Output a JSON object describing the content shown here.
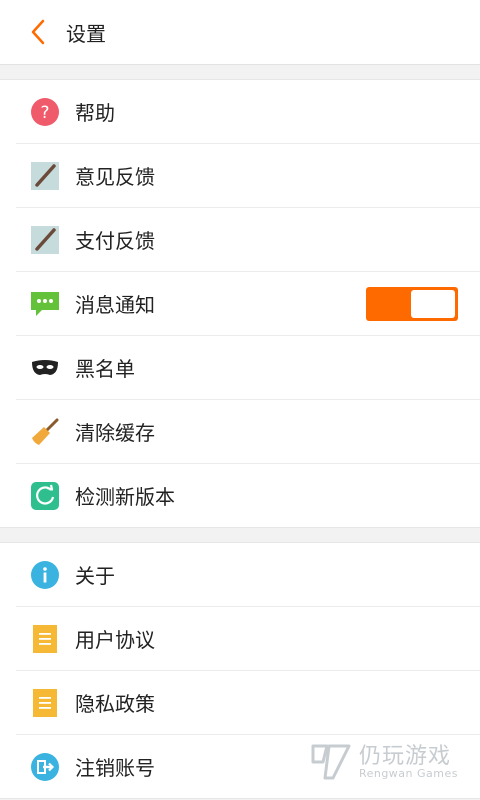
{
  "header": {
    "title": "设置",
    "back_icon": "chevron-left-icon",
    "accent": "#ff6a00"
  },
  "groups": [
    {
      "items": [
        {
          "label": "帮助",
          "icon": "help-icon"
        },
        {
          "label": "意见反馈",
          "icon": "pencil-icon"
        },
        {
          "label": "支付反馈",
          "icon": "pencil-icon"
        },
        {
          "label": "消息通知",
          "icon": "chat-bubble-icon",
          "toggle": {
            "on": true,
            "color": "#ff6a00"
          }
        },
        {
          "label": "黑名单",
          "icon": "mask-icon"
        },
        {
          "label": "清除缓存",
          "icon": "broom-icon"
        },
        {
          "label": "检测新版本",
          "icon": "refresh-icon"
        }
      ]
    },
    {
      "items": [
        {
          "label": "关于",
          "icon": "info-icon"
        },
        {
          "label": "用户协议",
          "icon": "document-icon"
        },
        {
          "label": "隐私政策",
          "icon": "document-icon"
        },
        {
          "label": "注销账号",
          "icon": "logout-icon"
        }
      ]
    }
  ],
  "watermark": {
    "main": "仍玩游戏",
    "sub": "Rengwan Games"
  }
}
